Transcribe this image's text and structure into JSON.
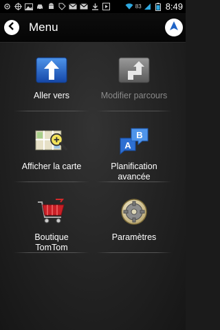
{
  "status_bar": {
    "battery_percent": "83",
    "time": "8:49"
  },
  "header": {
    "title": "Menu"
  },
  "menu": {
    "items": [
      {
        "label": "Aller vers",
        "icon": "arrow-up-icon",
        "enabled": true
      },
      {
        "label": "Modifier parcours",
        "icon": "route-change-icon",
        "enabled": false
      },
      {
        "label": "Afficher la carte",
        "icon": "map-magnifier-icon",
        "enabled": true
      },
      {
        "label": "Planification avancée",
        "icon": "ab-route-icon",
        "enabled": true
      },
      {
        "label": "Boutique TomTom",
        "icon": "shopping-cart-icon",
        "enabled": true
      },
      {
        "label": "Paramètres",
        "icon": "gear-icon",
        "enabled": true
      }
    ]
  },
  "colors": {
    "accent_blue": "#1f63c6",
    "background": "#1b1b1b",
    "disabled_text": "#8a8a8a"
  }
}
